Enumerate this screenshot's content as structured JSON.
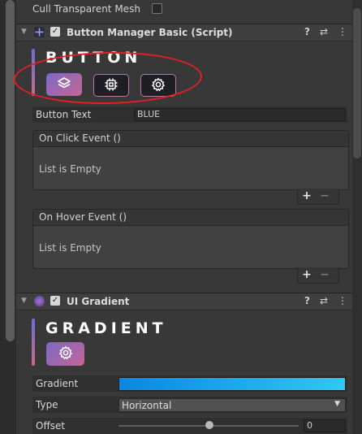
{
  "top": {
    "cull_label": "Cull Transparent Mesh",
    "cull_checked": false
  },
  "button_manager": {
    "component_title": "Button Manager Basic (Script)",
    "enabled": true,
    "banner_title": "BUTTON",
    "button_text_label": "Button Text",
    "button_text_value": "BLUE",
    "events": [
      {
        "title": "On Click Event ()",
        "empty_text": "List is Empty",
        "add": "+",
        "remove": "−"
      },
      {
        "title": "On Hover Event ()",
        "empty_text": "List is Empty",
        "add": "+",
        "remove": "−"
      }
    ]
  },
  "ui_gradient": {
    "component_title": "UI Gradient",
    "enabled": true,
    "banner_title": "GRADIENT",
    "gradient_label": "Gradient",
    "gradient_colors": [
      "#0c86e0",
      "#2ec9f2"
    ],
    "type_label": "Type",
    "type_value": "Horizontal",
    "offset_label": "Offset",
    "offset_value": "0"
  },
  "header_icons": {
    "help": "?",
    "presets": "⇄",
    "menu": "⋮"
  },
  "colors": {
    "accent_start": "#6b6fd8",
    "accent_end": "#c86a88",
    "annotation": "#e41e24"
  }
}
